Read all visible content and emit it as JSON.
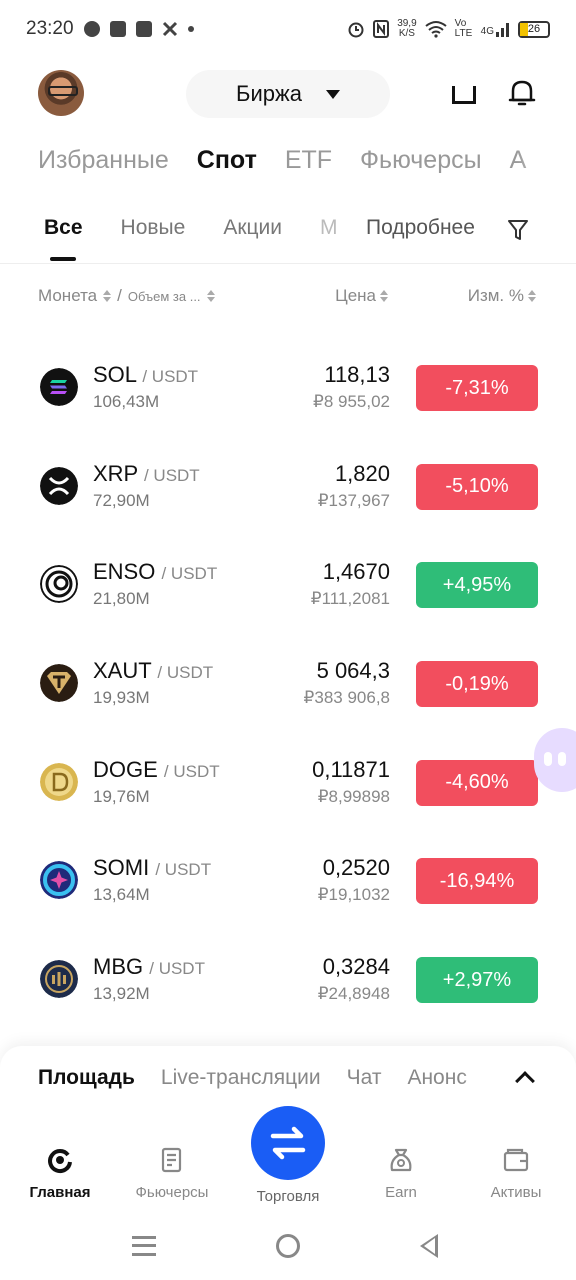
{
  "status_bar": {
    "time": "23:20",
    "net_speed_value": "39,9",
    "net_speed_unit": "K/S",
    "volte": "Vo LTE",
    "network": "4G",
    "battery": "26"
  },
  "header": {
    "exchange_label": "Биржа"
  },
  "market_tabs": [
    "Избранные",
    "Спот",
    "ETF",
    "Фьючерсы",
    "А"
  ],
  "sub_tabs": [
    "Все",
    "Новые",
    "Акции",
    "М"
  ],
  "more_label": "Подробнее",
  "columns": {
    "coin": "Монета",
    "separator": "/",
    "volume": "Объем за ...",
    "price": "Цена",
    "change": "Изм. %"
  },
  "coins": [
    {
      "symbol": "SOL",
      "quote": "/ USDT",
      "volume": "106,43M",
      "price": "118,13",
      "price_rub": "₽8 955,02",
      "change": "-7,31%"
    },
    {
      "symbol": "XRP",
      "quote": "/ USDT",
      "volume": "72,90M",
      "price": "1,820",
      "price_rub": "₽137,967",
      "change": "-5,10%"
    },
    {
      "symbol": "ENSO",
      "quote": "/ USDT",
      "volume": "21,80M",
      "price": "1,4670",
      "price_rub": "₽111,2081",
      "change": "+4,95%"
    },
    {
      "symbol": "XAUT",
      "quote": "/ USDT",
      "volume": "19,93M",
      "price": "5 064,3",
      "price_rub": "₽383 906,8",
      "change": "-0,19%"
    },
    {
      "symbol": "DOGE",
      "quote": "/ USDT",
      "volume": "19,76M",
      "price": "0,11871",
      "price_rub": "₽8,99898",
      "change": "-4,60%"
    },
    {
      "symbol": "SOMI",
      "quote": "/ USDT",
      "volume": "13,64M",
      "price": "0,2520",
      "price_rub": "₽19,1032",
      "change": "-16,94%"
    },
    {
      "symbol": "MBG",
      "quote": "/ USDT",
      "volume": "13,92M",
      "price": "0,3284",
      "price_rub": "₽24,8948",
      "change": "+2,97%"
    }
  ],
  "colors": {
    "negative": "#f24e5e",
    "positive": "#2fbd78",
    "accent": "#1a5df5"
  },
  "feed_tabs": [
    "Площадь",
    "Live-трансляции",
    "Чат",
    "Анонс"
  ],
  "bottom_nav": {
    "home": "Главная",
    "futures": "Фьючерсы",
    "trade": "Торговля",
    "earn": "Earn",
    "assets": "Активы"
  }
}
